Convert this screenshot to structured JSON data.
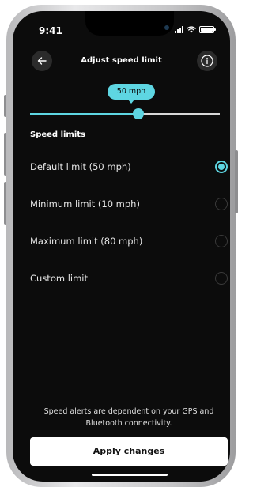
{
  "status": {
    "time": "9:41"
  },
  "header": {
    "title": "Adjust speed limit",
    "back_icon": "arrow-left-icon",
    "info_icon": "info-icon"
  },
  "slider": {
    "value_label": "50 mph",
    "value": 50,
    "min": 10,
    "max": 80,
    "accent": "#5ed6e2"
  },
  "speed_limits": {
    "heading": "Speed limits",
    "options": [
      {
        "label": "Default limit (50 mph)",
        "selected": true
      },
      {
        "label": "Minimum limit (10 mph)",
        "selected": false
      },
      {
        "label": "Maximum limit (80 mph)",
        "selected": false
      },
      {
        "label": "Custom limit",
        "selected": false
      }
    ]
  },
  "footer": {
    "note": "Speed alerts are dependent on your GPS and Bluetooth connectivity.",
    "apply_label": "Apply changes"
  }
}
